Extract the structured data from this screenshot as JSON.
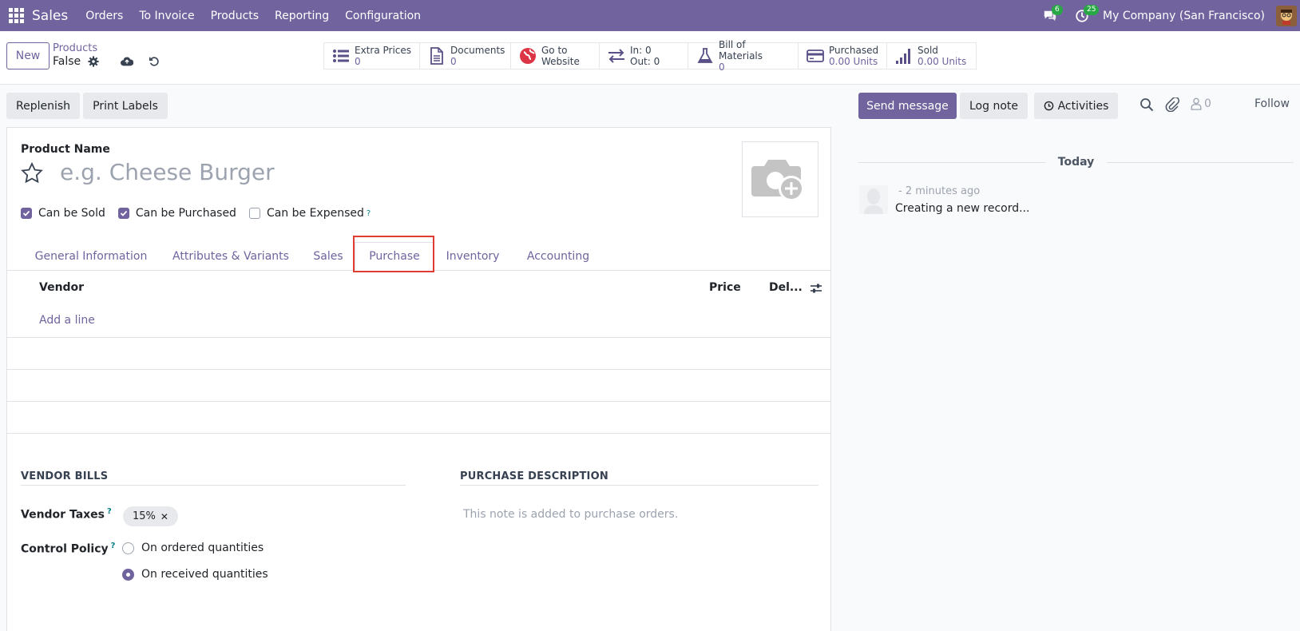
{
  "navbar": {
    "app_name": "Sales",
    "menu": [
      "Orders",
      "To Invoice",
      "Products",
      "Reporting",
      "Configuration"
    ],
    "messages_count": "6",
    "activities_count": "25",
    "company": "My Company (San Francisco)"
  },
  "control_panel": {
    "new_label": "New",
    "breadcrumb_parent": "Products",
    "record_name": "False",
    "smart_buttons": [
      {
        "label": "Extra Prices",
        "value": "0",
        "icon": "list-icon"
      },
      {
        "label": "Documents",
        "value": "0",
        "icon": "document-icon"
      },
      {
        "label": "Go to",
        "value": "Website",
        "icon": "globe-icon"
      },
      {
        "label": "In: 0",
        "value": "Out: 0",
        "icon": "transfer-arrows-icon"
      },
      {
        "label": "Bill of Materials",
        "value": "0",
        "icon": "flask-icon"
      },
      {
        "label": "Purchased",
        "value": "0.00 Units",
        "icon": "credit-card-icon"
      },
      {
        "label": "Sold",
        "value": "0.00 Units",
        "icon": "bar-signal-icon"
      }
    ]
  },
  "actions": {
    "replenish": "Replenish",
    "print_labels": "Print Labels",
    "send_message": "Send message",
    "log_note": "Log note",
    "activities": "Activities",
    "followers_count": "0",
    "follow": "Follow"
  },
  "form": {
    "product_name_label": "Product Name",
    "product_name_placeholder": "e.g. Cheese Burger",
    "checkboxes": [
      {
        "label": "Can be Sold",
        "checked": true
      },
      {
        "label": "Can be Purchased",
        "checked": true
      },
      {
        "label": "Can be Expensed",
        "checked": false,
        "help": "?"
      }
    ],
    "tabs": [
      "General Information",
      "Attributes & Variants",
      "Sales",
      "Purchase",
      "Inventory",
      "Accounting"
    ],
    "active_tab": "Purchase",
    "vendor_list": {
      "col_vendor": "Vendor",
      "col_price": "Price",
      "col_delivery": "Del...",
      "add_line": "Add a line"
    },
    "vendor_bills": {
      "title": "VENDOR BILLS",
      "vendor_taxes_label": "Vendor Taxes",
      "tax_tag": "15%",
      "control_policy_label": "Control Policy",
      "options": [
        {
          "label": "On ordered quantities",
          "selected": false
        },
        {
          "label": "On received quantities",
          "selected": true
        }
      ],
      "help": "?"
    },
    "purchase_description": {
      "title": "PURCHASE DESCRIPTION",
      "placeholder": "This note is added to purchase orders."
    }
  },
  "chatter": {
    "date_separator": "Today",
    "message_time": "- 2 minutes ago",
    "message_body": "Creating a new record..."
  },
  "colors": {
    "brand": "#71639e",
    "highlight": "#e03c31",
    "badge": "#28a745"
  }
}
